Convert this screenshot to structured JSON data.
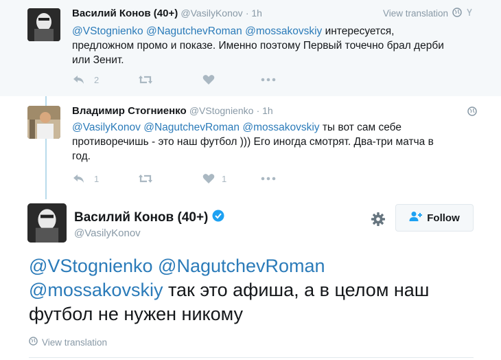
{
  "tweet1": {
    "fullname": "Василий Конов (40+)",
    "handle": "@VasilyKonov",
    "time": "· 1h",
    "view_translation": "View translation",
    "mentions": [
      "@VStognienko",
      "@NagutchevRoman",
      "@mossakovskiy"
    ],
    "text_line1_rest": " интересуется,",
    "text_line2": "предложном промо и показе. Именно поэтому Первый точечно брал дерби",
    "text_line3": "или Зенит.",
    "reply_count": "2",
    "retweet_count": "",
    "like_count": ""
  },
  "tweet2": {
    "fullname": "Владимир Стогниенко",
    "handle": "@VStognienko",
    "time": "· 1h",
    "mentions": [
      "@VasilyKonov",
      "@NagutchevRoman",
      "@mossakovskiy"
    ],
    "text_line1_rest": " ты вот сам себе",
    "text_line2": "противоречишь - это наш футбол ))) Его иногда смотрят. Два-три матча в",
    "text_line3": "год.",
    "reply_count": "1",
    "retweet_count": "",
    "like_count": "1"
  },
  "main_tweet": {
    "fullname": "Василий Конов (40+)",
    "handle": "@VasilyKonov",
    "follow_label": "Follow",
    "mentions": [
      "@VStognienko",
      "@NagutchevRoman",
      "@mossakovskiy"
    ],
    "text_line2_rest": " так это афиша, а в целом наш",
    "text_line3": "футбол не нужен никому",
    "view_translation": "View translation"
  },
  "colors": {
    "link": "#2b7bb9",
    "verified": "#1da1f2",
    "thread_line": "#b8dbeb",
    "meta": "#8899a6"
  },
  "icons": [
    "reply-icon",
    "retweet-icon",
    "like-icon",
    "more-icon",
    "globe-icon",
    "verified-icon",
    "gear-icon",
    "follow-person-icon"
  ]
}
